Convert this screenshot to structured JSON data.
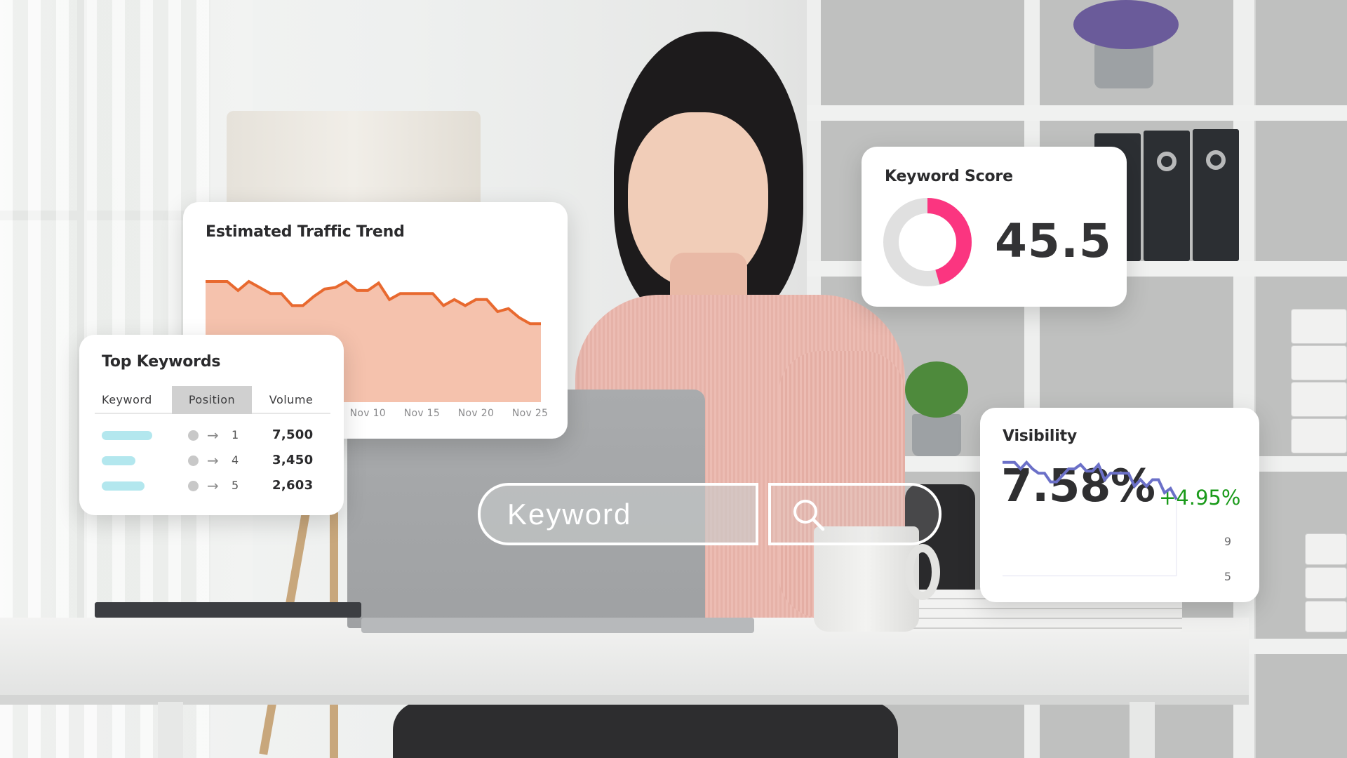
{
  "traffic_card": {
    "title": "Estimated Traffic Trend",
    "series_color": "#e8692f",
    "fill_color": "#f5c2ad"
  },
  "keywords_card": {
    "title": "Top Keywords",
    "columns": [
      "Keyword",
      "Position",
      "Volume"
    ],
    "active_column": "Position",
    "rows": [
      {
        "keyword_bar_fraction": 0.82,
        "arrow": "→",
        "position": "1",
        "volume": "7,500"
      },
      {
        "keyword_bar_fraction": 0.54,
        "arrow": "→",
        "position": "4",
        "volume": "3,450"
      },
      {
        "keyword_bar_fraction": 0.69,
        "arrow": "→",
        "position": "5",
        "volume": "2,603"
      }
    ],
    "bar_color": "#b3e7ee"
  },
  "score_card": {
    "title": "Keyword Score",
    "value": "45.5",
    "score_fraction": 0.455,
    "arc_color": "#fb3580",
    "track_color": "#e0e0e0"
  },
  "visibility_card": {
    "title": "Visibility",
    "value": "7.58%",
    "delta": "+4.95%",
    "delta_color": "#1a9a1a",
    "line_color": "#6b70c8"
  },
  "search": {
    "placeholder": "Keyword",
    "button_icon": "search-icon"
  },
  "chart_data": [
    {
      "type": "area",
      "title": "Estimated Traffic Trend",
      "xlabel": "",
      "ylabel": "",
      "x_tick_labels": [
        "Nov 10",
        "Nov 15",
        "Nov 20",
        "Nov 25"
      ],
      "x": [
        "Oct 26",
        "Oct 27",
        "Oct 28",
        "Oct 29",
        "Oct 30",
        "Oct 31",
        "Nov 1",
        "Nov 2",
        "Nov 3",
        "Nov 4",
        "Nov 5",
        "Nov 6",
        "Nov 7",
        "Nov 8",
        "Nov 9",
        "Nov 10",
        "Nov 11",
        "Nov 12",
        "Nov 13",
        "Nov 14",
        "Nov 15",
        "Nov 16",
        "Nov 17",
        "Nov 18",
        "Nov 19",
        "Nov 20",
        "Nov 21",
        "Nov 22",
        "Nov 23",
        "Nov 24",
        "Nov 25",
        "Nov 26"
      ],
      "values": [
        80,
        80,
        80,
        74,
        80,
        76,
        72,
        72,
        64,
        64,
        70,
        75,
        76,
        80,
        74,
        74,
        79,
        68,
        72,
        72,
        72,
        72,
        64,
        68,
        64,
        68,
        68,
        60,
        62,
        56,
        52,
        52
      ],
      "ylim": [
        0,
        100
      ],
      "grid": false,
      "legend": "none"
    },
    {
      "type": "line",
      "title": "Visibility",
      "y_tick_labels": [
        "9",
        "5"
      ],
      "values": [
        9.6,
        9.6,
        9.6,
        9.3,
        9.6,
        9.3,
        9.1,
        9.1,
        8.7,
        8.7,
        9.0,
        9.3,
        9.3,
        9.5,
        9.2,
        9.2,
        9.5,
        8.8,
        9.1,
        9.1,
        9.1,
        9.1,
        8.5,
        8.8,
        8.5,
        8.8,
        8.8,
        8.2,
        8.4,
        7.9
      ],
      "ylim": [
        5,
        10.5
      ],
      "grid": false,
      "legend": "none"
    }
  ]
}
